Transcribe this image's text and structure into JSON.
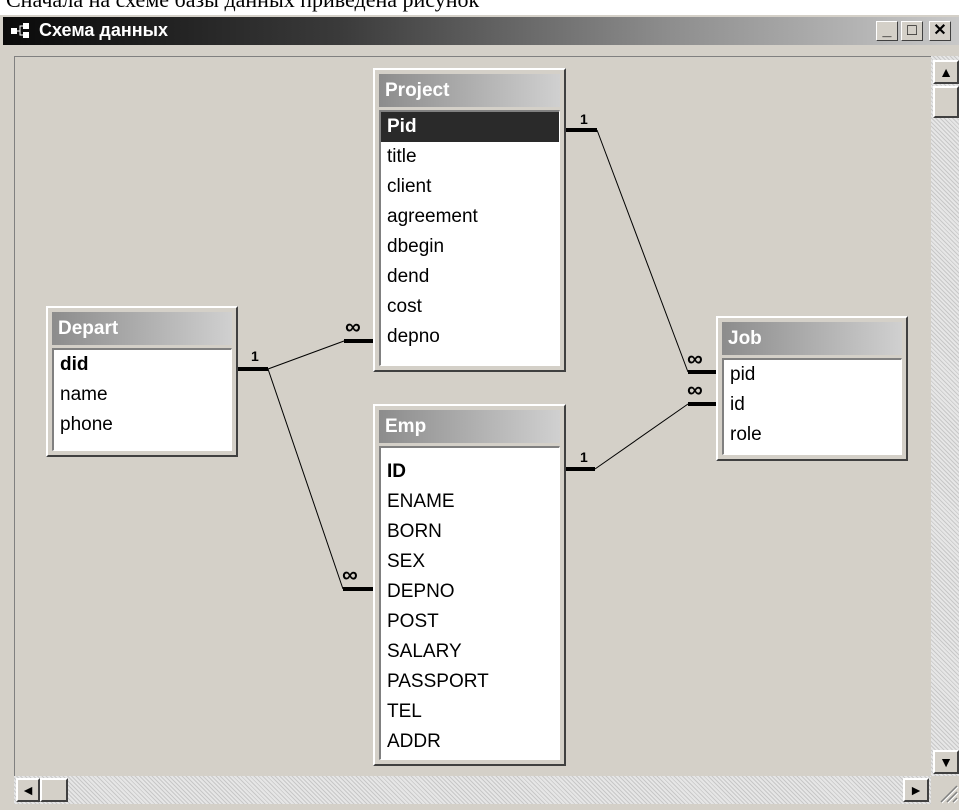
{
  "document_text_cut": "Сначала на схеме базы данных приведена рисунок",
  "window": {
    "title": "Схема данных",
    "minimize": "_",
    "maximize": "□",
    "close": "✕"
  },
  "scrollbar": {
    "up": "▲",
    "down": "▼",
    "left": "◄",
    "right": "►"
  },
  "tables": {
    "depart": {
      "name": "Depart",
      "fields": [
        "did",
        "name",
        "phone"
      ]
    },
    "project": {
      "name": "Project",
      "fields": [
        "Pid",
        "title",
        "client",
        "agreement",
        "dbegin",
        "dend",
        "cost",
        "depno"
      ]
    },
    "emp": {
      "name": "Emp",
      "fields": [
        "ID",
        "ENAME",
        "BORN",
        "SEX",
        "DEPNO",
        "POST",
        "SALARY",
        "PASSPORT",
        "TEL",
        "ADDR"
      ]
    },
    "job": {
      "name": "Job",
      "fields": [
        "pid",
        "id",
        "role"
      ]
    }
  },
  "relations": {
    "one": "1",
    "many": "∞"
  }
}
